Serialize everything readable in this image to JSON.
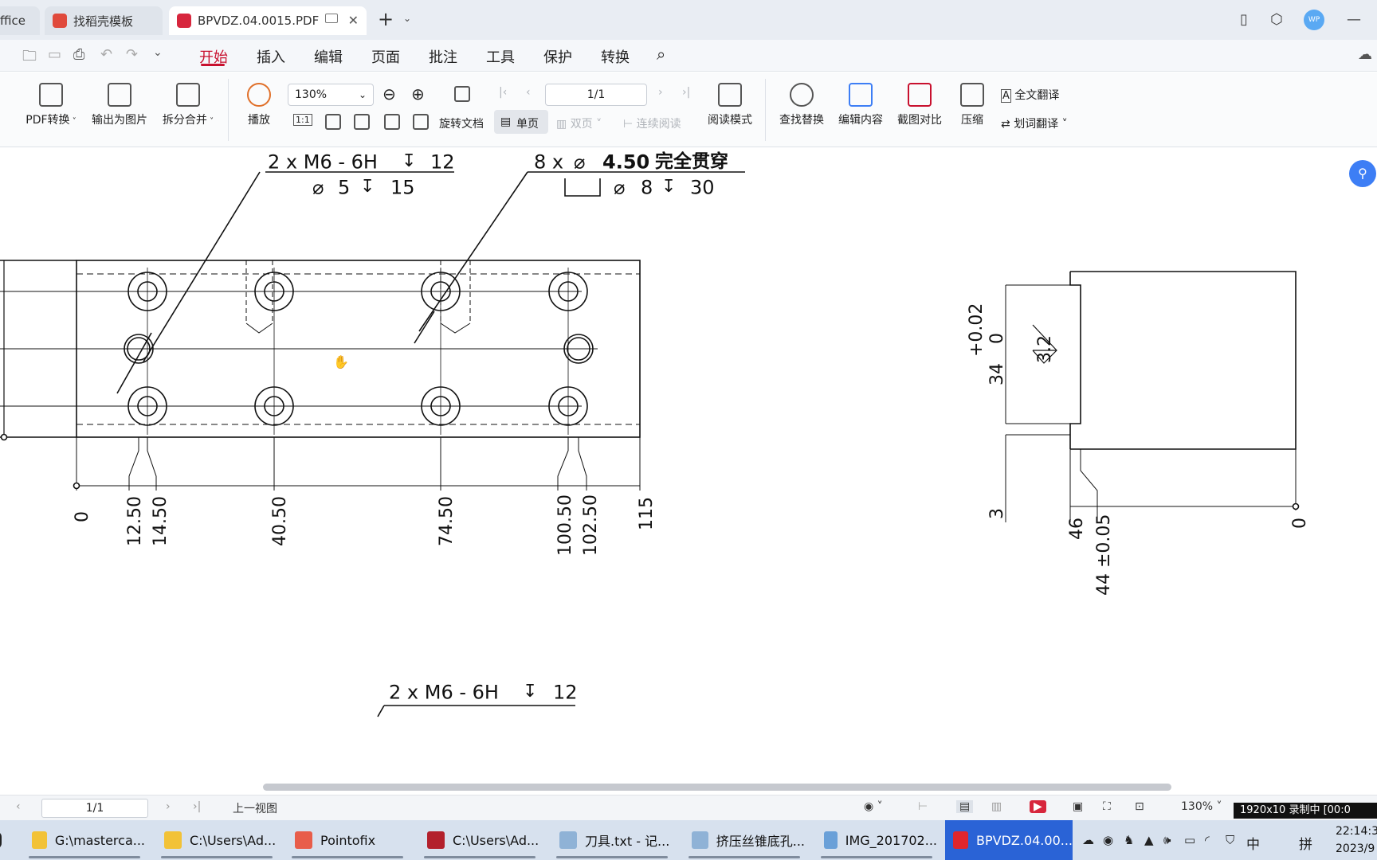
{
  "tabs": [
    {
      "label": "ffice"
    },
    {
      "label": "找稻壳模板"
    },
    {
      "label": "BPVDZ.04.0015.PDF"
    }
  ],
  "menu": [
    "开始",
    "插入",
    "编辑",
    "页面",
    "批注",
    "工具",
    "保护",
    "转换"
  ],
  "ribbon": {
    "pdf_convert": "PDF转换",
    "export_image": "输出为图片",
    "split_merge": "拆分合并",
    "play": "播放",
    "zoom": "130%",
    "page": "1/1",
    "rotate": "旋转文档",
    "single": "单页",
    "double": "双页",
    "continuous": "连续阅读",
    "read_mode": "阅读模式",
    "find_replace": "查找替换",
    "edit_content": "编辑内容",
    "screenshot_compare": "截图对比",
    "compress": "压缩",
    "full_translate": "全文翻译",
    "word_translate": "划词翻译",
    "ratio_label": "1:1"
  },
  "drawing": {
    "callout1_line1": "2 x  M6 - 6H",
    "callout1_depth": "12",
    "callout1_line2": "5",
    "callout1_line2_depth": "15",
    "callout2_line1_prefix": "8 x",
    "callout2_dia": "4.50",
    "callout2_thru": "完全贯穿",
    "callout2_line2_dia": "8",
    "callout2_line2_depth": "30",
    "dims_x": [
      "0",
      "12.50",
      "14.50",
      "40.50",
      "74.50",
      "100.50",
      "102.50",
      "115"
    ],
    "side_tol": "+0.02",
    "side_tol2": "0",
    "side_34": "34",
    "side_rough": "3.2",
    "side_3": "3",
    "side_46": "46",
    "side_44": "44 ±0.05",
    "side_0": "0",
    "callout3_line1": "2 x  M6 - 6H",
    "callout3_depth": "12"
  },
  "status": {
    "page": "1/1",
    "prev_view": "上一视图",
    "zoom": "130%",
    "recording": "1920x10 录制中 [00:0"
  },
  "taskbar": [
    {
      "label": "G:\\masterca..."
    },
    {
      "label": "C:\\Users\\Ad..."
    },
    {
      "label": "Pointofix"
    },
    {
      "label": "C:\\Users\\Ad..."
    },
    {
      "label": "刀具.txt - 记..."
    },
    {
      "label": "挤压丝锥底孔..."
    },
    {
      "label": "IMG_201702..."
    },
    {
      "label": "BPVDZ.04.00..."
    }
  ],
  "tray": {
    "ime": "中",
    "layout": "拼",
    "time": "22:14:3",
    "date": "2023/9"
  },
  "avatar": "WP",
  "colors": {
    "accent": "#c8102e",
    "taskbar_active": "#2a63d6",
    "float": "#3d7ef5"
  }
}
